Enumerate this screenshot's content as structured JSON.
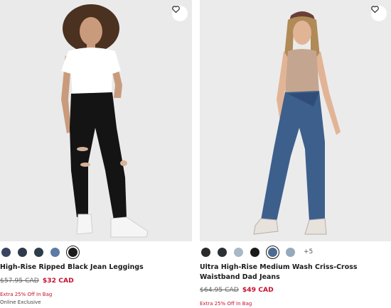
{
  "products": [
    {
      "title": "High-Rise Ripped Black Jean Leggings",
      "was_price": "$57.95 CAD",
      "sale_price": "$32 CAD",
      "promo": "Extra 25% Off In Bag",
      "badge": "Online Exclusive",
      "swatch_colors": [
        "#3a4660",
        "#2f3a4d",
        "#2e3d4a",
        "#5b7aa6",
        "#1b1b1b"
      ],
      "selected_swatch": 4
    },
    {
      "title": "Ultra High-Rise Medium Wash Criss-Cross Waistband Dad Jeans",
      "was_price": "$64.95 CAD",
      "sale_price": "$49 CAD",
      "promo": "Extra 25% Off In Bag",
      "swatch_colors": [
        "#2a2a2a",
        "#2c2f33",
        "#a8b8c6",
        "#1a1a1a",
        "#4b6b92",
        "#96a9bd"
      ],
      "selected_swatch": 4,
      "more_colors": "+5"
    }
  ],
  "icons": {
    "favorite": "heart-outline-icon"
  },
  "colors": {
    "sale": "#c8102e",
    "photo_bg": "#ececec"
  }
}
